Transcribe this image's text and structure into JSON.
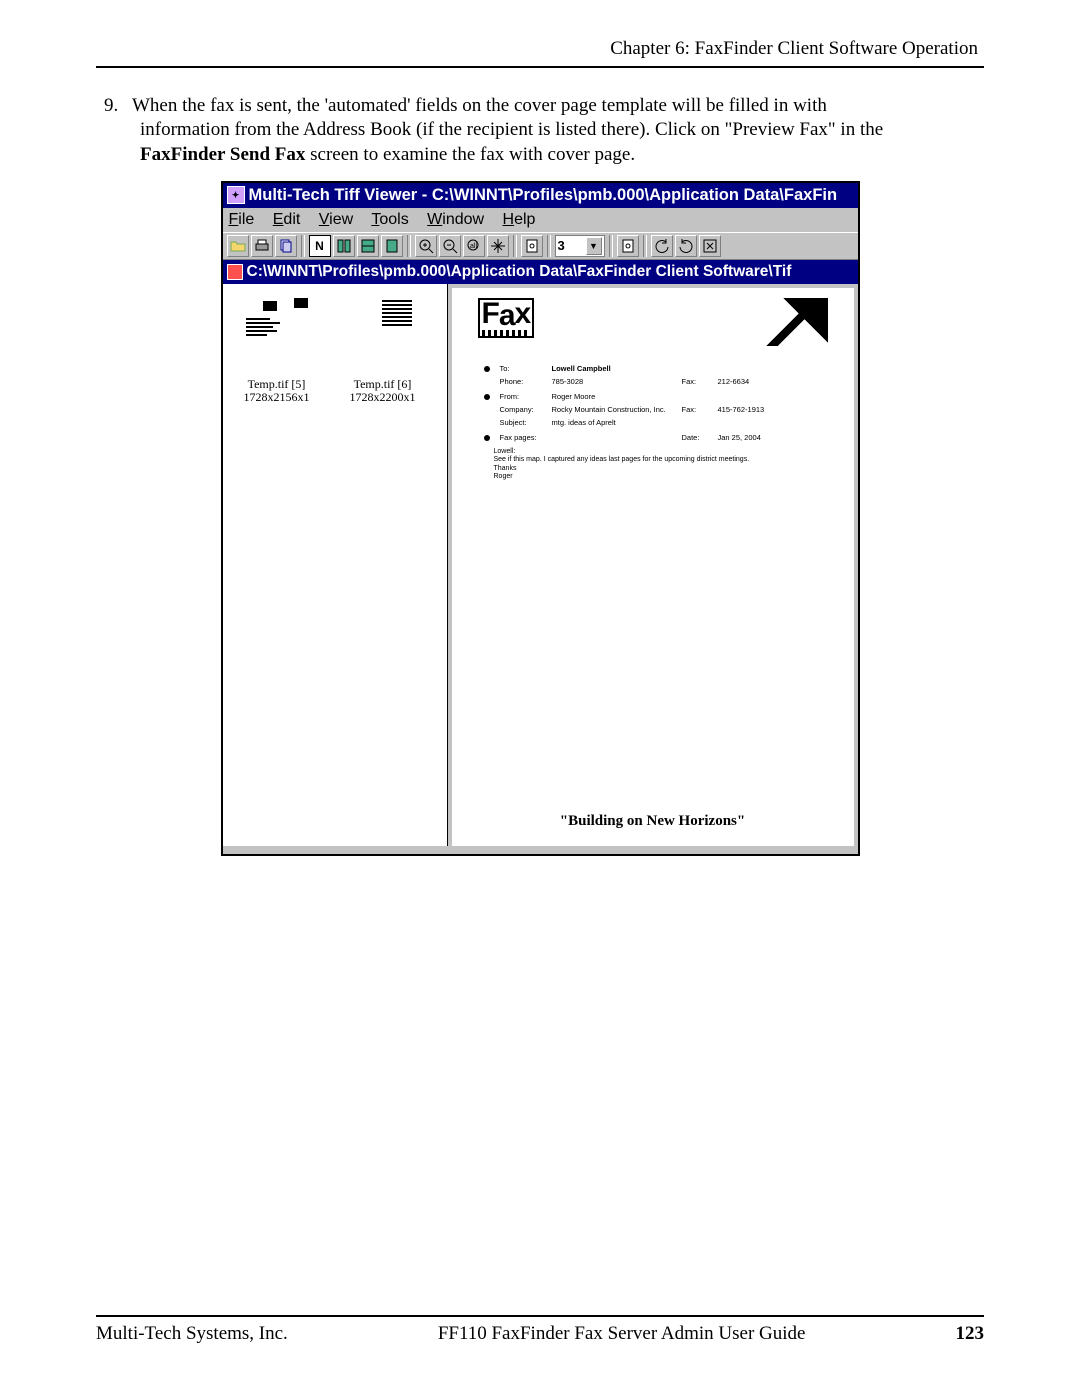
{
  "header": {
    "chapter": "Chapter 6:  FaxFinder Client Software Operation"
  },
  "body": {
    "step_number": "9.",
    "line1": "When the fax is sent, the 'automated' fields on the cover page template will be filled in with",
    "line2": "information from the Address Book (if the recipient is listed there).  Click on \"Preview Fax\" in the",
    "line3_bold": "FaxFinder Send Fax",
    "line3_rest": " screen to examine the fax with cover page."
  },
  "window": {
    "title": "Multi-Tech Tiff Viewer - C:\\WINNT\\Profiles\\pmb.000\\Application Data\\FaxFin",
    "menus": {
      "file": "File",
      "edit": "Edit",
      "view": "View",
      "tools": "Tools",
      "window": "Window",
      "help": "Help"
    },
    "toolbar": {
      "page_field": "3"
    },
    "pathbar": "C:\\WINNT\\Profiles\\pmb.000\\Application Data\\FaxFinder Client Software\\Tif",
    "thumbs": [
      {
        "name": "Temp.tif [5]",
        "dims": "1728x2156x1"
      },
      {
        "name": "Temp.tif [6]",
        "dims": "1728x2200x1"
      }
    ],
    "cover": {
      "to_label": "To:",
      "to_val": "Lowell Campbell",
      "phone_label": "Phone:",
      "phone_val": "785-3028",
      "fax_label": "Fax:",
      "fax_val": "212-6634",
      "from_label": "From:",
      "from_val": "Roger Moore",
      "company_label": "Company:",
      "company_val": "Rocky Mountain Construction,  Inc.",
      "from_fax_label": "Fax:",
      "from_fax_val": "415-762-1913",
      "subject_label": "Subject:",
      "subject_val": "mtg. ideas of Aprelt",
      "pages_label": "Fax pages:",
      "date_label": "Date:",
      "date_val": "Jan 25, 2004",
      "msg_greeting": "Lowell:",
      "msg_line": "See if this map. I captured any ideas last pages for the upcoming district meetings.",
      "msg_sign1": "Thanks",
      "msg_sign2": "Roger",
      "footer_tag": "\"Building on New Horizons\""
    }
  },
  "footer": {
    "left": "Multi-Tech Systems, Inc.",
    "center": "FF110 FaxFinder Fax Server Admin User Guide",
    "page": "123"
  }
}
